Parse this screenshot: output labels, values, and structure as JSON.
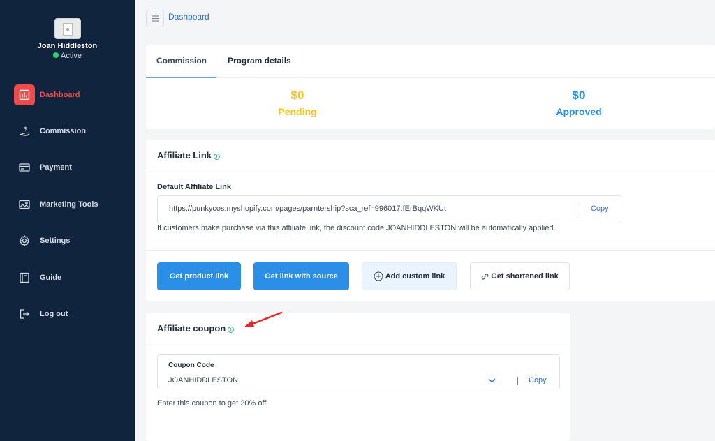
{
  "sidebar": {
    "user": {
      "name": "Joan Hiddleston",
      "status": "Active"
    },
    "items": [
      {
        "label": "Dashboard",
        "icon": "bar-chart-icon",
        "active": true
      },
      {
        "label": "Commission",
        "icon": "hand-coin-icon"
      },
      {
        "label": "Payment",
        "icon": "credit-card-icon"
      },
      {
        "label": "Marketing Tools",
        "icon": "image-icon"
      },
      {
        "label": "Settings",
        "icon": "gear-icon"
      },
      {
        "label": "Guide",
        "icon": "book-icon"
      },
      {
        "label": "Log out",
        "icon": "logout-icon"
      }
    ]
  },
  "header": {
    "breadcrumb": "Dashboard"
  },
  "tabs": [
    {
      "label": "Commission",
      "active": true
    },
    {
      "label": "Program details"
    }
  ],
  "stats": {
    "pending": {
      "amount": "$0",
      "label": "Pending"
    },
    "approved": {
      "amount": "$0",
      "label": "Approved"
    }
  },
  "affiliate_link": {
    "title": "Affiliate Link",
    "field_label": "Default Affiliate Link",
    "url": "https://punkycos.myshopify.com/pages/parntership?sca_ref=996017.fErBqqWKUt",
    "copy_label": "Copy",
    "hint": "If customers make purchase via this affiliate link, the discount code JOANHIDDLESTON will be automatically applied.",
    "buttons": {
      "product": "Get product link",
      "source": "Get link with source",
      "custom": "Add custom link",
      "shortened": "Get shortened link"
    }
  },
  "coupon": {
    "title": "Affiliate coupon",
    "field_label": "Coupon Code",
    "value": "JOANHIDDLESTON",
    "copy_label": "Copy",
    "note": "Enter this coupon to get 20% off"
  },
  "colors": {
    "sidebar_bg": "#10243e",
    "active": "#ef4b4b",
    "primary": "#2b8fe8",
    "pending": "#f5c518",
    "link": "#2f6fd0"
  }
}
